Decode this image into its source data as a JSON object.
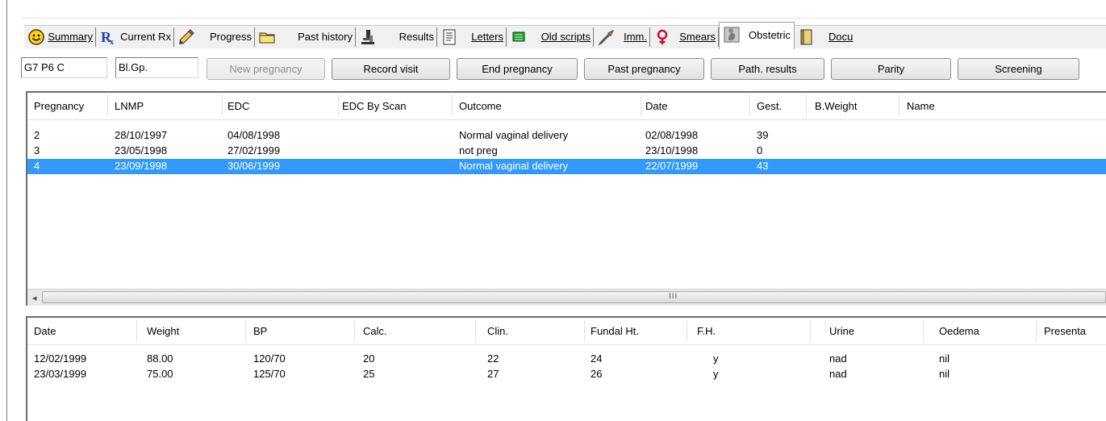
{
  "colors": {
    "selection": "#3399ff",
    "tab_bg": "#f0f0f0",
    "button_bg": "#ececec"
  },
  "tabs": [
    {
      "label": "Summary",
      "icon": "smiley-icon",
      "active": false
    },
    {
      "label": "Current Rx",
      "icon": "prescription-icon",
      "active": false
    },
    {
      "label": "Progress",
      "icon": "pen-notes-icon",
      "active": false
    },
    {
      "label": "Past history",
      "icon": "folder-icon",
      "active": false
    },
    {
      "label": "Results",
      "icon": "microscope-icon",
      "active": false
    },
    {
      "label": "Letters",
      "icon": "document-icon",
      "active": false
    },
    {
      "label": "Old scripts",
      "icon": "pill-pack-icon",
      "active": false
    },
    {
      "label": "Imm.",
      "icon": "syringe-icon",
      "active": false
    },
    {
      "label": "Smears",
      "icon": "female-symbol-icon",
      "active": false
    },
    {
      "label": "Obstetric",
      "icon": "pregnancy-icon",
      "active": true
    },
    {
      "label": "Docu",
      "icon": "notebook-icon",
      "active": false
    }
  ],
  "toolbar": {
    "gravida_value": "G7 P6 C",
    "blood_group_value": "Bl.Gp.",
    "buttons": {
      "new_pregnancy": "New pregnancy",
      "record_visit": "Record visit",
      "end_pregnancy": "End pregnancy",
      "past_pregnancy": "Past pregnancy",
      "path_results": "Path. results",
      "parity": "Parity",
      "screening": "Screening"
    }
  },
  "pregnancies": {
    "columns": [
      "Pregnancy",
      "LNMP",
      "EDC",
      "EDC By Scan",
      "Outcome",
      "Date",
      "Gest.",
      "B.Weight",
      "Name"
    ],
    "rows": [
      {
        "pregnancy": "2",
        "lnmp": "28/10/1997",
        "edc": "04/08/1998",
        "edc_scan": "",
        "outcome": "Normal vaginal delivery",
        "date": "02/08/1998",
        "gest": "39",
        "bweight": "",
        "name": "",
        "selected": false
      },
      {
        "pregnancy": "3",
        "lnmp": "23/05/1998",
        "edc": "27/02/1999",
        "edc_scan": "",
        "outcome": "not preg",
        "date": "23/10/1998",
        "gest": "0",
        "bweight": "",
        "name": "",
        "selected": false
      },
      {
        "pregnancy": "4",
        "lnmp": "23/09/1998",
        "edc": "30/06/1999",
        "edc_scan": "",
        "outcome": "Normal vaginal delivery",
        "date": "22/07/1999",
        "gest": "43",
        "bweight": "",
        "name": "",
        "selected": true
      }
    ],
    "scroll_left_arrow": "◂",
    "scroll_grip": "III"
  },
  "visits": {
    "columns": [
      "Date",
      "Weight",
      "BP",
      "Calc.",
      "Clin.",
      "Fundal Ht.",
      "F.H.",
      "Urine",
      "Oedema",
      "Presenta"
    ],
    "rows": [
      {
        "date": "12/02/1999",
        "weight": "88.00",
        "bp": "120/70",
        "calc": "20",
        "clin": "22",
        "fundal": "24",
        "fh": "y",
        "urine": "nad",
        "oedema": "nil",
        "presentation": ""
      },
      {
        "date": "23/03/1999",
        "weight": "75.00",
        "bp": "125/70",
        "calc": "25",
        "clin": "27",
        "fundal": "26",
        "fh": "y",
        "urine": "nad",
        "oedema": "nil",
        "presentation": ""
      }
    ]
  }
}
